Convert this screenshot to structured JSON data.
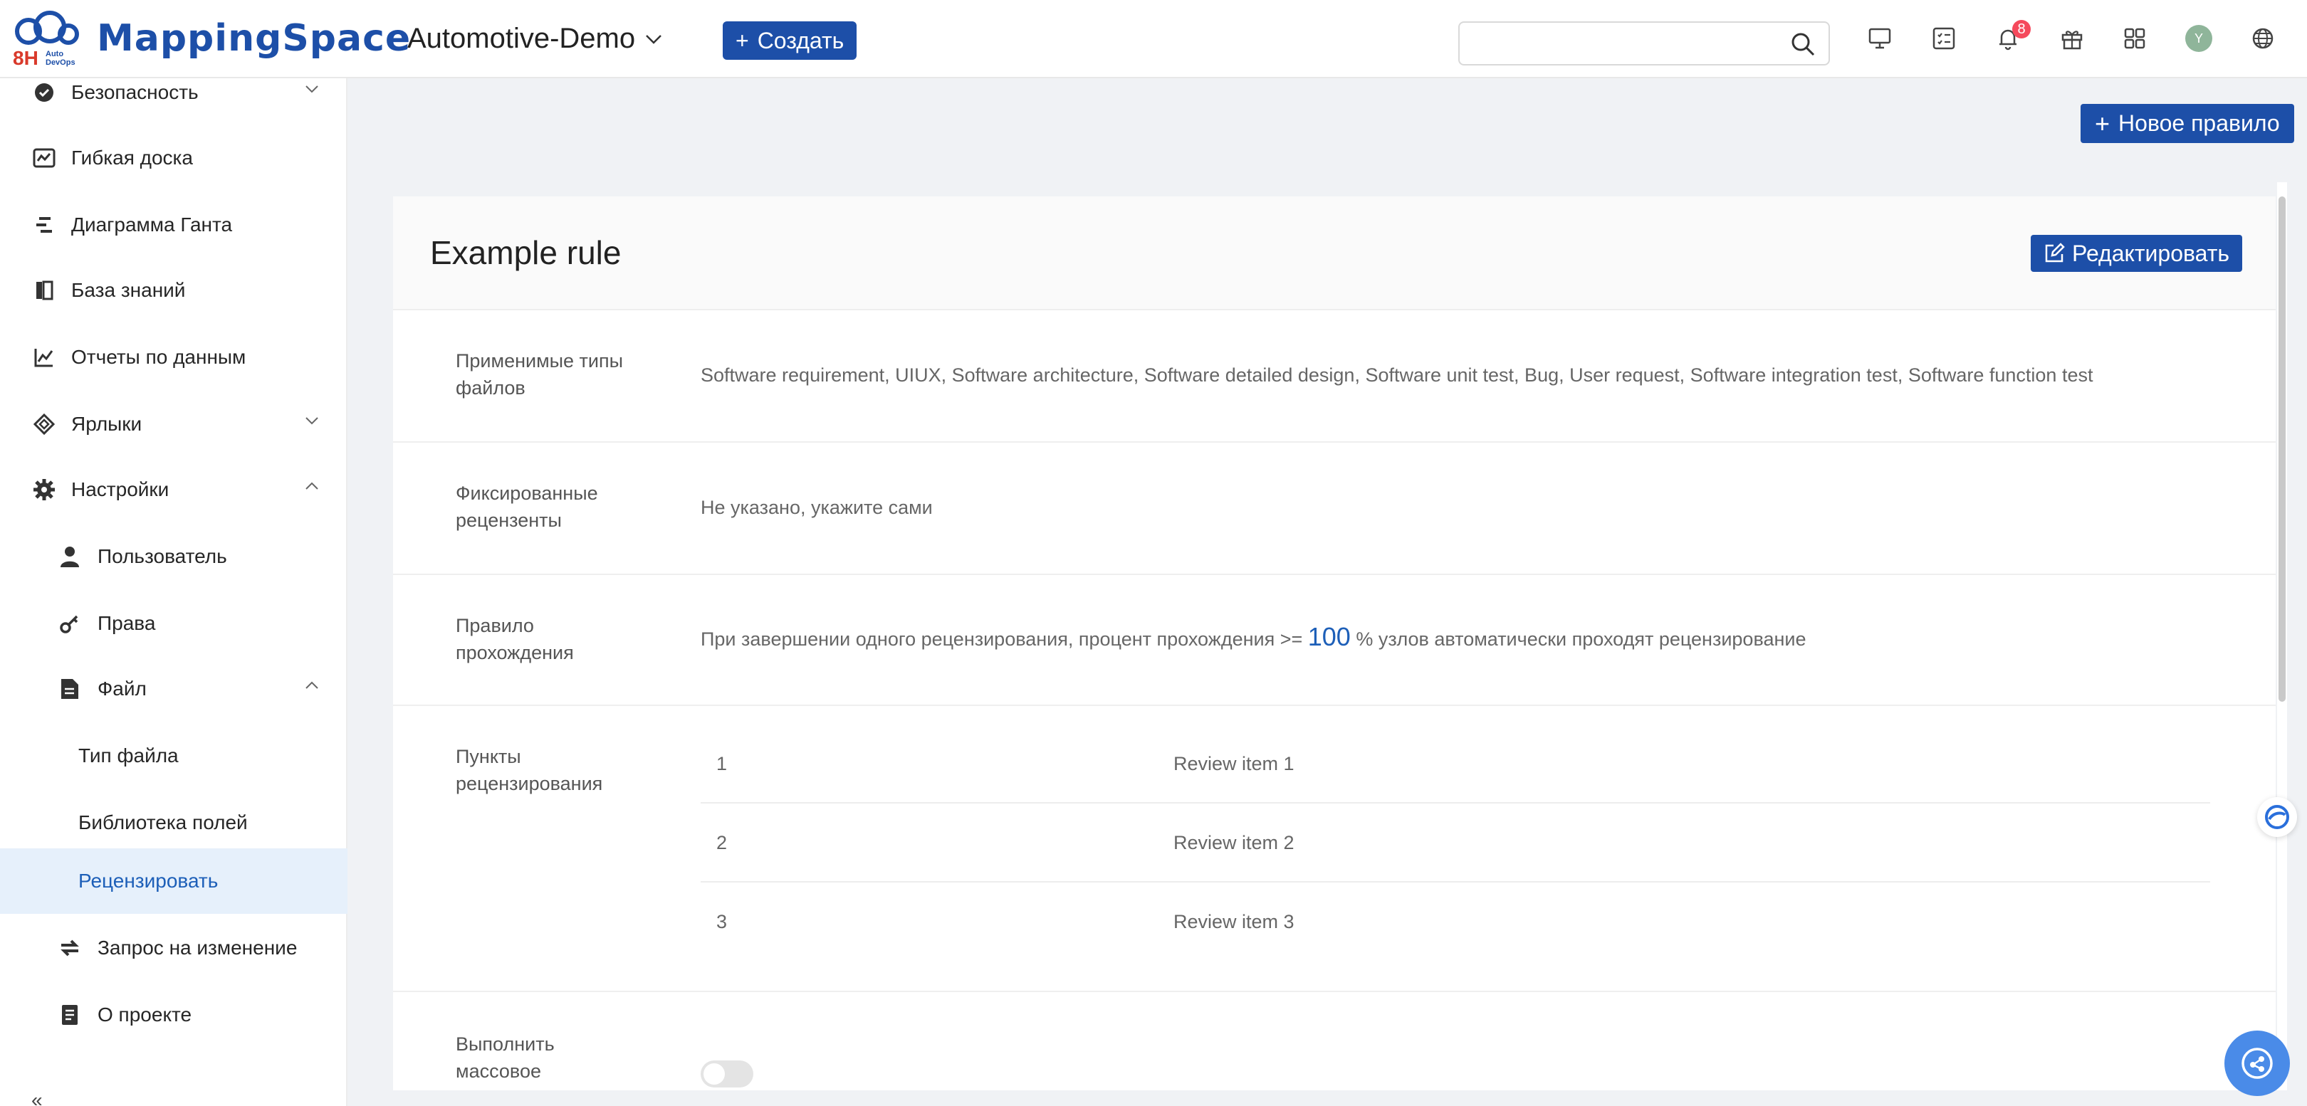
{
  "header": {
    "logo_text": "MappingSpace",
    "logo_badge": "8H",
    "logo_sub": "Auto DevOps",
    "project": "Automotive-Demo",
    "create_label": "Создать",
    "search_placeholder": "",
    "notification_count": "8",
    "avatar_initial": "Y"
  },
  "sidebar": {
    "items": [
      {
        "label": "Безопасность",
        "icon": "shield-check-icon"
      },
      {
        "label": "Гибкая доска",
        "icon": "agile-board-icon"
      },
      {
        "label": "Диаграмма Ганта",
        "icon": "gantt-icon"
      },
      {
        "label": "База знаний",
        "icon": "book-icon"
      },
      {
        "label": "Отчеты по данным",
        "icon": "chart-icon"
      },
      {
        "label": "Ярлыки",
        "icon": "tag-icon"
      },
      {
        "label": "Настройки",
        "icon": "gear-icon"
      },
      {
        "label": "Пользователь",
        "icon": "user-icon"
      },
      {
        "label": "Права",
        "icon": "key-icon"
      },
      {
        "label": "Файл",
        "icon": "file-icon"
      },
      {
        "label": "Тип файла"
      },
      {
        "label": "Библиотека полей"
      },
      {
        "label": "Рецензировать"
      },
      {
        "label": "Запрос на изменение",
        "icon": "swap-icon"
      },
      {
        "label": "О проекте",
        "icon": "document-icon"
      }
    ],
    "active": "Рецензировать",
    "collapse_glyph": "«"
  },
  "main": {
    "new_rule_label": "Новое правило",
    "rule": {
      "title": "Example rule",
      "edit_label": "Редактировать",
      "rows": {
        "types": {
          "label": "Применимые типы файлов",
          "value": "Software requirement, UIUX, Software architecture, Software detailed design, Software unit test, Bug, User request, Software integration test, Software function test"
        },
        "reviewers": {
          "label": "Фиксированные рецензенты",
          "value": "Не указано, укажите сами"
        },
        "pass": {
          "label": "Правило прохождения",
          "value_prefix": "При завершении одного рецензирования, процент прохождения >=",
          "percent": "100",
          "value_suffix": "% узлов автоматически проходят рецензирование"
        },
        "items": {
          "label": "Пункты рецензирования",
          "list": [
            {
              "num": "1",
              "text": "Review item 1"
            },
            {
              "num": "2",
              "text": "Review item 2"
            },
            {
              "num": "3",
              "text": "Review item 3"
            }
          ]
        },
        "bulk": {
          "label": "Выполнить массовое",
          "enabled": false
        }
      }
    }
  },
  "colors": {
    "primary": "#1d4fa8",
    "active_bg": "#e6f0fb",
    "badge": "#f5495c"
  }
}
